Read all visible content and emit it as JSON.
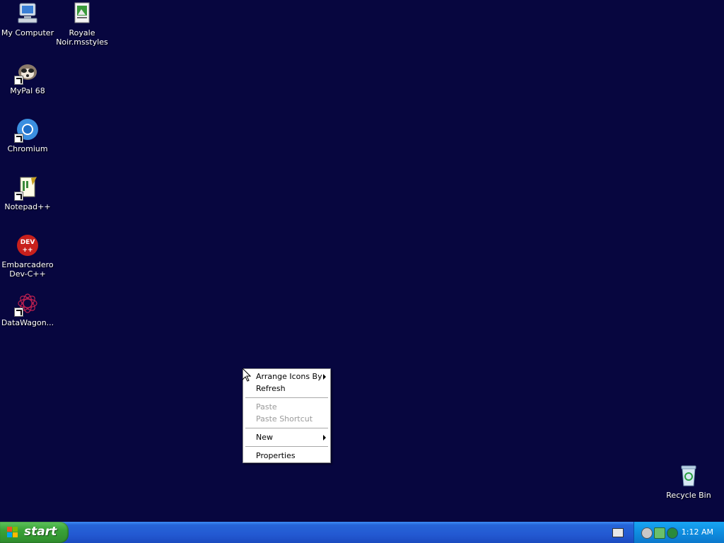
{
  "desktop": {
    "icons": [
      {
        "label": "My Computer"
      },
      {
        "label": "Royale Noir.msstyles"
      },
      {
        "label": "MyPal 68"
      },
      {
        "label": "Chromium"
      },
      {
        "label": "Notepad++"
      },
      {
        "label": "Embarcadero Dev-C++"
      },
      {
        "label": "DataWagon..."
      },
      {
        "label": "Recycle Bin"
      }
    ]
  },
  "context_menu": {
    "items": [
      {
        "label": "Arrange Icons By",
        "submenu": true,
        "enabled": true
      },
      {
        "label": "Refresh",
        "submenu": false,
        "enabled": true
      },
      {
        "label": "Paste",
        "submenu": false,
        "enabled": false
      },
      {
        "label": "Paste Shortcut",
        "submenu": false,
        "enabled": false
      },
      {
        "label": "New",
        "submenu": true,
        "enabled": true
      },
      {
        "label": "Properties",
        "submenu": false,
        "enabled": true
      }
    ]
  },
  "taskbar": {
    "start_label": "start",
    "clock": "1:12 AM",
    "tray_icons": [
      "speaker-icon",
      "network-icon",
      "globe-icon"
    ],
    "keyboard_icon": "keyboard-icon"
  },
  "colors": {
    "desktop_bg": "#07063f",
    "taskbar": "#2359d2",
    "start_button": "#39a237",
    "tray": "#0f8de0"
  }
}
